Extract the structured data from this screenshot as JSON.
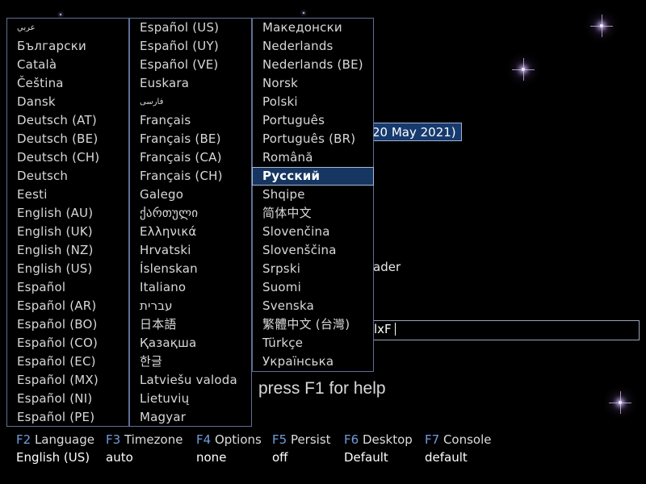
{
  "background": {
    "color": "#000000",
    "star_color": "#c9b3e8"
  },
  "behind_dialog": {
    "version_fragment": "20 May 2021)",
    "loader_fragment": "ader",
    "input_fragment": "lxF",
    "help_text": "press F1 for help"
  },
  "language_menu": {
    "selected": "Русский",
    "columns": [
      [
        "عربي",
        "Български",
        "Català",
        "Čeština",
        "Dansk",
        "Deutsch (AT)",
        "Deutsch (BE)",
        "Deutsch (CH)",
        "Deutsch",
        "Eesti",
        "English (AU)",
        "English (UK)",
        "English (NZ)",
        "English (US)",
        "Español",
        "Español (AR)",
        "Español (BO)",
        "Español (CO)",
        "Español (EC)",
        "Español (MX)",
        "Español (NI)",
        "Español (PE)"
      ],
      [
        "Español (US)",
        "Español (UY)",
        "Español (VE)",
        "Euskara",
        "فارسی",
        "Français",
        "Français (BE)",
        "Français (CA)",
        "Français (CH)",
        "Galego",
        "ქართული",
        "Ελληνικά",
        "Hrvatski",
        "Íslenskan",
        "Italiano",
        "עברית",
        "日本語",
        "Қазақша",
        "한글",
        "Latviešu valoda",
        "Lietuvių",
        "Magyar"
      ],
      [
        "Македонски",
        "Nederlands",
        "Nederlands (BE)",
        "Norsk",
        "Polski",
        "Português",
        "Português (BR)",
        "Română",
        "Русский",
        "Shqipe",
        "简体中文",
        "Slovenčina",
        "Slovenščina",
        "Srpski",
        "Suomi",
        "Svenska",
        "繁體中文 (台灣)",
        "Türkçe",
        "Українська"
      ]
    ]
  },
  "function_keys": [
    {
      "key": "F2",
      "name": "Language",
      "value": "English (US)"
    },
    {
      "key": "F3",
      "name": "Timezone",
      "value": "auto"
    },
    {
      "key": "F4",
      "name": "Options",
      "value": "none"
    },
    {
      "key": "F5",
      "name": "Persist",
      "value": "off"
    },
    {
      "key": "F6",
      "name": "Desktop",
      "value": "Default"
    },
    {
      "key": "F7",
      "name": "Console",
      "value": "default"
    }
  ],
  "colors": {
    "key_color": "#6f9de0",
    "selection_bg": "#163661",
    "border": "#5f6f95"
  }
}
